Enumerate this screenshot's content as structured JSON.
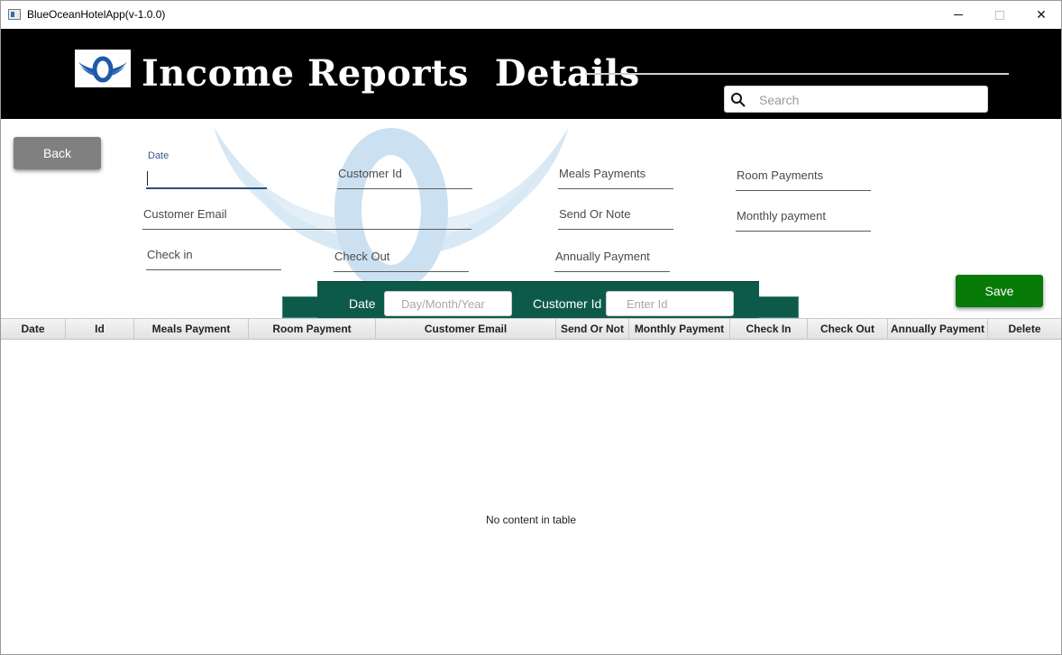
{
  "window": {
    "title": "BlueOceanHotelApp(v-1.0.0)",
    "minimize": "minimize",
    "maximize": "maximize",
    "close": "✕"
  },
  "header": {
    "title": "Income Reports  Details",
    "search_placeholder": "Search",
    "logo_icon": "blue-ocean-logo-icon"
  },
  "back_label": "Back",
  "save_label": "Save",
  "form": {
    "date_label": "Date",
    "customer_id_label": "Customer Id",
    "meals_payments_label": "Meals Payments",
    "room_payments_label": "Room Payments",
    "customer_email_label": "Customer Email",
    "send_or_note_label": "Send Or Note",
    "monthly_payment_label": "Monthly payment",
    "check_in_label": "Check in",
    "check_out_label": "Check Out",
    "annually_payment_label": "Annually Payment"
  },
  "filter": {
    "date_label": "Date",
    "date_placeholder": "Day/Month/Year",
    "customer_id_label": "Customer Id",
    "customer_id_placeholder": "Enter Id"
  },
  "table": {
    "columns": [
      "Date",
      "Id",
      "Meals Payment",
      "Room Payment",
      "Customer Email",
      "Send Or Not",
      "Monthly Payment",
      "Check In",
      "Check Out",
      "Annually Payment",
      "Delete"
    ],
    "empty_message": "No content in table"
  },
  "colors": {
    "header_bg": "#000000",
    "filter_bar": "#0d5a4b",
    "save_button": "#087a08",
    "back_button": "#808080",
    "focus_underline": "#2e4f7d"
  }
}
